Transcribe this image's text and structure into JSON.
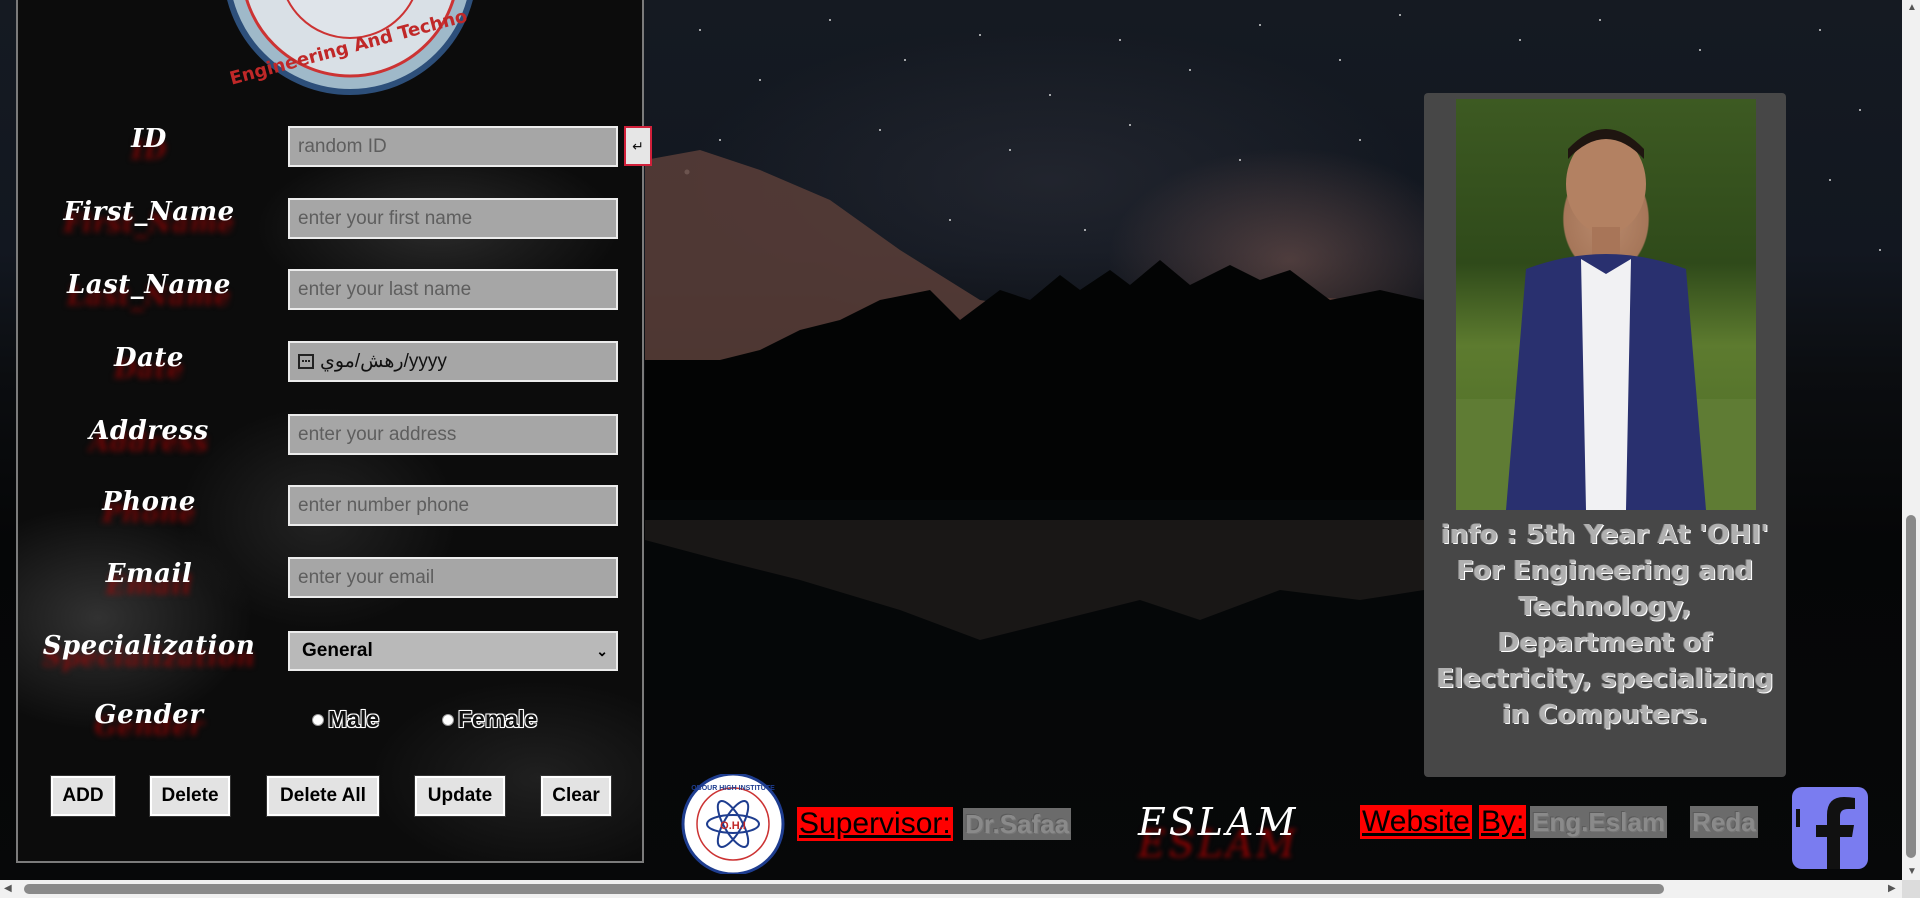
{
  "form": {
    "fields": [
      {
        "label": "ID",
        "placeholder": "random ID"
      },
      {
        "label": "First_Name",
        "placeholder": "enter your first name"
      },
      {
        "label": "Last_Name",
        "placeholder": "enter your last name"
      },
      {
        "label": "Date",
        "value": "رهش/موي/yyyy"
      },
      {
        "label": "Address",
        "placeholder": "enter your address"
      },
      {
        "label": "Phone",
        "placeholder": "enter number phone"
      },
      {
        "label": "Email",
        "placeholder": "enter your email"
      }
    ],
    "generate_id_label": "↵",
    "specialization": {
      "label": "Specialization",
      "selected": "General"
    },
    "gender": {
      "label": "Gender",
      "options": [
        "Male",
        "Female"
      ]
    },
    "buttons": {
      "add": "ADD",
      "delete": "Delete",
      "delete_all": "Delete All",
      "update": "Update",
      "clear": "Clear"
    }
  },
  "logo": {
    "top_ring_text": "Engineering And Techno",
    "footer_ring_text": "OBOUR HIGH INSTITUTE",
    "footer_center": "O.H.I"
  },
  "footer": {
    "supervisor_label": "Supervisor:",
    "supervisor_name": "Dr.Safaa",
    "signature": "ESLAM",
    "website_label": "Website",
    "by_label": "By:",
    "author_first": "Eng.Eslam",
    "author_last": "Reda",
    "facebook_glyph": "f"
  },
  "profile": {
    "info": "info : 5th Year At 'OHI' For Engineering and Technology, Department of Electricity, specializing in Computers."
  },
  "colors": {
    "accent_red": "#ff0000",
    "facebook": "#7a7cf0",
    "card": "#474747"
  }
}
